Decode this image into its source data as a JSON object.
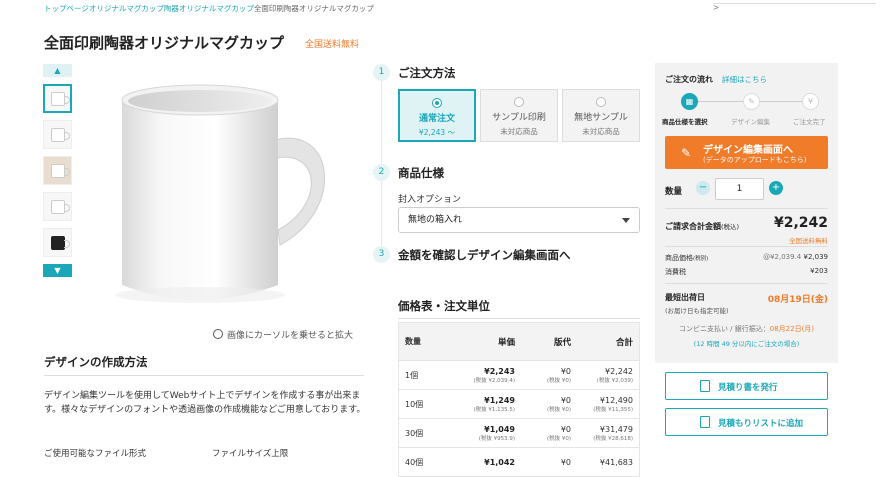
{
  "breadcrumb": {
    "items": [
      "トップページ",
      "オリジナルマグカップ",
      "陶器オリジナルマグカップ",
      "全面印刷陶器オリジナルマグカップ"
    ],
    "separator": ">"
  },
  "product": {
    "title": "全面印刷陶器オリジナルマグカップ",
    "free_shipping": "全国送料無料",
    "zoom_hint": "画像にカーソルを乗せると拡大"
  },
  "howto": {
    "title": "デザインの作成方法",
    "text": "デザイン編集ツールを使用してWebサイト上でデザインを作成する事が出来ます。様々なデザインのフォントや透過画像の作成機能などご用意しております。",
    "file_formats_label": "ご使用可能なファイル形式",
    "file_size_label": "ファイルサイズ上限"
  },
  "order": {
    "step1": {
      "num": "1",
      "label": "ご注文方法"
    },
    "step2": {
      "num": "2",
      "label": "商品仕様"
    },
    "step3": {
      "num": "3",
      "label": "金額を確認しデザイン編集画面へ"
    },
    "options": [
      {
        "label": "通常注文",
        "sub": "¥2,243 〜"
      },
      {
        "label": "サンプル印刷",
        "sub": "未対応商品"
      },
      {
        "label": "無地サンプル",
        "sub": "未対応商品"
      }
    ],
    "wrap_label": "封入オプション",
    "wrap_value": "無地の箱入れ"
  },
  "price_table": {
    "title": "価格表・注文単位",
    "headers": [
      "数量",
      "単価",
      "版代",
      "合計"
    ],
    "rows": [
      {
        "qty": "1個",
        "unit": "¥2,243",
        "unit_tax": "(税抜 ¥2,039.4)",
        "plate": "¥0",
        "plate_tax": "(税抜 ¥0)",
        "total": "¥2,242",
        "total_tax": "(税抜 ¥2,039)"
      },
      {
        "qty": "10個",
        "unit": "¥1,249",
        "unit_tax": "(税抜 ¥1,135.5)",
        "plate": "¥0",
        "plate_tax": "(税抜 ¥0)",
        "total": "¥12,490",
        "total_tax": "(税抜 ¥11,355)"
      },
      {
        "qty": "30個",
        "unit": "¥1,049",
        "unit_tax": "(税抜 ¥953.9)",
        "plate": "¥0",
        "plate_tax": "(税抜 ¥0)",
        "total": "¥31,479",
        "total_tax": "(税抜 ¥28,618)"
      },
      {
        "qty": "40個",
        "unit": "¥1,042",
        "unit_tax": "",
        "plate": "¥0",
        "plate_tax": "",
        "total": "¥41,683",
        "total_tax": ""
      }
    ]
  },
  "side": {
    "flow_title": "ご注文の流れ",
    "flow_link": "詳細はこちら",
    "flow_steps": [
      "商品仕様を選択",
      "デザイン編集",
      "ご注文完了"
    ],
    "flow_icons": [
      "gift-icon",
      "pencil-icon",
      "yen-icon"
    ],
    "design_button": "デザイン編集画面へ",
    "design_button_sub": "(データのアップロードもこちら)",
    "qty_label": "数量",
    "qty_value": "1",
    "total_label": "ご請求合計金額",
    "total_label_small": "(税込)",
    "total_value": "¥2,242",
    "total_note": "全国送料無料",
    "item_price_label": "商品価格",
    "item_price_small": "(税別)",
    "item_price_detail": "@¥2,039.4",
    "item_price_value": "¥2,039",
    "tax_label": "消費税",
    "tax_value": "¥203",
    "ship_label": "最短出荷日",
    "ship_sub": "(お届け日も指定可能)",
    "ship_date": "08月19日(金)",
    "conv_text": "コンビニ支払い / 銀行振込：",
    "conv_date": "08月22日(月)",
    "conv_deadline": "(12 時間 49 分以内にご注文の場合)",
    "quote_button": "見積り書を発行",
    "quote_list_button": "見積もりリストに追加"
  },
  "colors": {
    "accent": "#1aa7b8",
    "orange": "#f07b28"
  }
}
